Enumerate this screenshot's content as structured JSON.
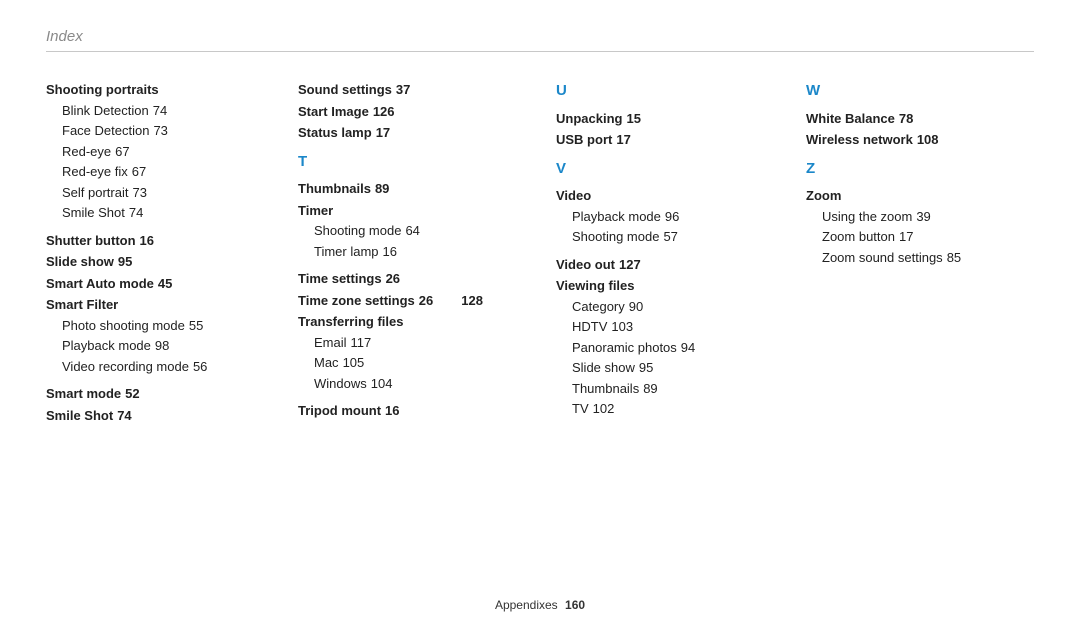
{
  "header": {
    "title": "Index"
  },
  "footer": {
    "section": "Appendixes",
    "page": "160"
  },
  "col1": {
    "shooting_portraits": "Shooting portraits",
    "blink_detection": "Blink Detection",
    "blink_detection_pg": "74",
    "face_detection": "Face Detection",
    "face_detection_pg": "73",
    "red_eye": "Red-eye",
    "red_eye_pg": "67",
    "red_eye_fix": "Red-eye fix",
    "red_eye_fix_pg": "67",
    "self_portrait": "Self portrait",
    "self_portrait_pg": "73",
    "smile_shot_sub": "Smile Shot",
    "smile_shot_sub_pg": "74",
    "shutter_button": "Shutter button",
    "shutter_button_pg": "16",
    "slide_show": "Slide show",
    "slide_show_pg": "95",
    "smart_auto_mode": "Smart Auto mode",
    "smart_auto_mode_pg": "45",
    "smart_filter": "Smart Filter",
    "photo_shooting_mode": "Photo shooting mode",
    "photo_shooting_mode_pg": "55",
    "playback_mode": "Playback mode",
    "playback_mode_pg": "98",
    "video_recording_mode": "Video recording mode",
    "video_recording_mode_pg": "56",
    "smart_mode": "Smart mode",
    "smart_mode_pg": "52",
    "smile_shot": "Smile Shot",
    "smile_shot_pg": "74"
  },
  "col2": {
    "sound_settings": "Sound settings",
    "sound_settings_pg": "37",
    "start_image": "Start Image",
    "start_image_pg": "126",
    "status_lamp": "Status lamp",
    "status_lamp_pg": "17",
    "letter_t": "T",
    "thumbnails": "Thumbnails",
    "thumbnails_pg": "89",
    "timer": "Timer",
    "shooting_mode": "Shooting mode",
    "shooting_mode_pg": "64",
    "timer_lamp": "Timer lamp",
    "timer_lamp_pg": "16",
    "time_settings": "Time settings",
    "time_settings_pg": "26",
    "time_zone_settings": "Time zone settings",
    "time_zone_settings_pg1": "26",
    "time_zone_settings_pg2": "128",
    "transferring_files": "Transferring files",
    "email": "Email",
    "email_pg": "117",
    "mac": "Mac",
    "mac_pg": "105",
    "windows": "Windows",
    "windows_pg": "104",
    "tripod_mount": "Tripod mount",
    "tripod_mount_pg": "16"
  },
  "col3": {
    "letter_u": "U",
    "unpacking": "Unpacking",
    "unpacking_pg": "15",
    "usb_port": "USB port",
    "usb_port_pg": "17",
    "letter_v": "V",
    "video": "Video",
    "playback_mode": "Playback mode",
    "playback_mode_pg": "96",
    "shooting_mode": "Shooting mode",
    "shooting_mode_pg": "57",
    "video_out": "Video out",
    "video_out_pg": "127",
    "viewing_files": "Viewing files",
    "category": "Category",
    "category_pg": "90",
    "hdtv": "HDTV",
    "hdtv_pg": "103",
    "panoramic_photos": "Panoramic photos",
    "panoramic_photos_pg": "94",
    "slide_show": "Slide show",
    "slide_show_pg": "95",
    "thumbnails": "Thumbnails",
    "thumbnails_pg": "89",
    "tv": "TV",
    "tv_pg": "102"
  },
  "col4": {
    "letter_w": "W",
    "white_balance": "White Balance",
    "white_balance_pg": "78",
    "wireless_network": "Wireless network",
    "wireless_network_pg": "108",
    "letter_z": "Z",
    "zoom": "Zoom",
    "using_the_zoom": "Using the zoom",
    "using_the_zoom_pg": "39",
    "zoom_button": "Zoom button",
    "zoom_button_pg": "17",
    "zoom_sound_settings": "Zoom sound settings",
    "zoom_sound_settings_pg": "85"
  }
}
